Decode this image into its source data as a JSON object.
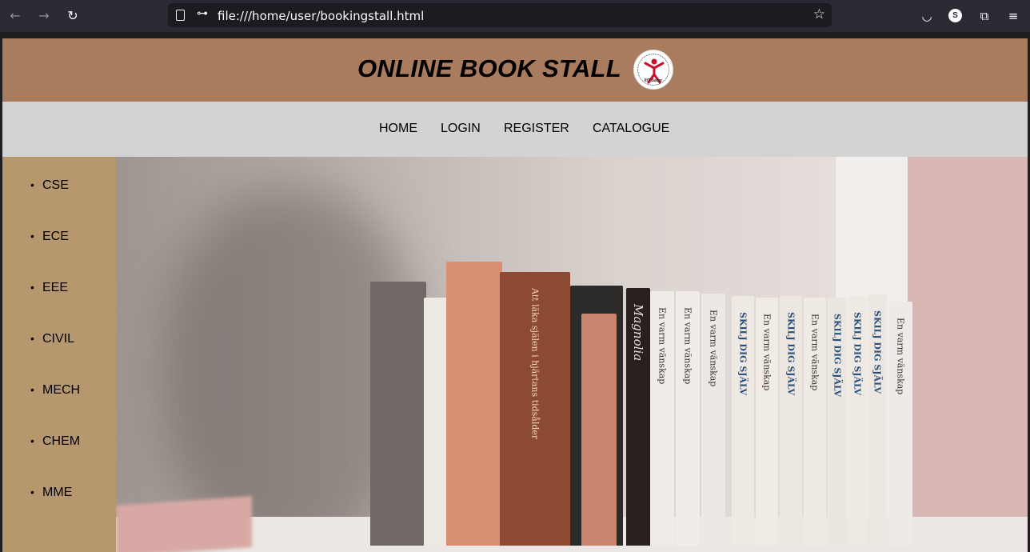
{
  "browser": {
    "url": "file:///home/user/bookingstall.html",
    "profile_initial": "S",
    "icons": [
      "back-icon",
      "forward-icon",
      "reload-icon",
      "page-icon",
      "permissions-icon",
      "bookmark-star-icon",
      "pocket-icon",
      "account-icon",
      "extensions-icon",
      "menu-icon"
    ]
  },
  "header": {
    "title": "ONLINE BOOK STALL",
    "logo_text": "IIIT Basar"
  },
  "nav": {
    "items": [
      "HOME",
      "LOGIN",
      "REGISTER",
      "CATALOGUE"
    ]
  },
  "sidebar": {
    "items": [
      "CSE",
      "ECE",
      "EEE",
      "CIVIL",
      "MECH",
      "CHEM",
      "MME"
    ]
  },
  "hero": {
    "spines": [
      "Att läka själen i hjärtans tidsålder",
      "Magnolia",
      "En varm vänskap",
      "En varm vänskap",
      "En varm vänskap",
      "SKILJ DIG SJÄLV",
      "En varm vänskap",
      "SKILJ DIG SJÄLV",
      "En varm vänskap",
      "SKILJ DIG SJÄLV",
      "SKILJ DIG SJÄLV",
      "SKILJ DIG SJÄLV",
      "En varm vänskap"
    ],
    "colors": {
      "header_bg": "#a97b5f",
      "nav_bg": "#d3d3d3",
      "sidebar_bg": "#b7976e"
    }
  }
}
